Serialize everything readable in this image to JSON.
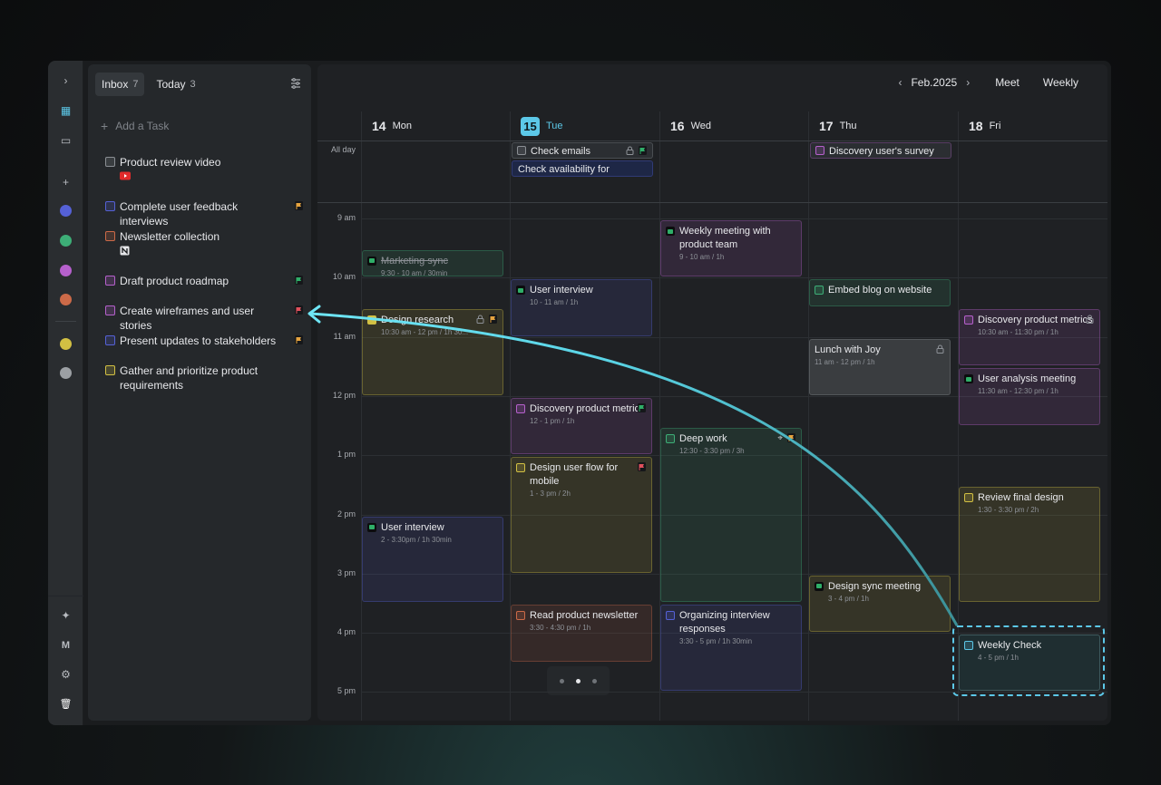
{
  "rail": {
    "icons": [
      "chevron-right-icon",
      "calendar-icon",
      "folder-icon",
      "plus-icon",
      "sparkle-icon",
      "brand-icon",
      "settings-icon",
      "trash-icon"
    ],
    "colors": [
      "#5561d6",
      "#3dae77",
      "#b660cc",
      "#cc6a48",
      "#d2c043",
      "#9ca0a4"
    ]
  },
  "tasks": {
    "tabs": [
      {
        "label": "Inbox",
        "count": "7"
      },
      {
        "label": "Today",
        "count": "3"
      }
    ],
    "add_label": "Add a Task",
    "items": [
      {
        "label": "Product review video",
        "color": "#8b8f94",
        "flag": "",
        "sub_icon": "youtube-icon"
      },
      {
        "label": "Complete user feedback interviews",
        "color": "#5561d6",
        "flag": "#e5a33f"
      },
      {
        "label": "Newsletter collection",
        "color": "#cc6a48",
        "flag": "",
        "sub_icon": "notion-icon"
      },
      {
        "label": "Draft product roadmap",
        "color": "#b660cc",
        "flag": "#2fae68"
      },
      {
        "label": "Create wireframes and user stories",
        "color": "#b660cc",
        "flag": "#e0505c"
      },
      {
        "label": "Present updates to stakeholders",
        "color": "#5561d6",
        "flag": "#e5a33f"
      },
      {
        "label": "Gather and prioritize product requirements",
        "color": "#d2c043",
        "flag": ""
      }
    ]
  },
  "calendar": {
    "month": "Feb.2025",
    "view_buttons": [
      "Meet",
      "Weekly"
    ],
    "days": [
      {
        "num": "14",
        "name": "Mon",
        "today": false
      },
      {
        "num": "15",
        "name": "Tue",
        "today": true
      },
      {
        "num": "16",
        "name": "Wed",
        "today": false
      },
      {
        "num": "17",
        "name": "Thu",
        "today": false
      },
      {
        "num": "18",
        "name": "Fri",
        "today": false
      }
    ],
    "allday_label": "All day",
    "hours": [
      "9 am",
      "10 am",
      "11 am",
      "12 pm",
      "1 pm",
      "2 pm",
      "3 pm",
      "4 pm",
      "5 pm"
    ],
    "allday_events": [
      {
        "title": "Check emails",
        "day": 1,
        "row": 0,
        "color": "#8b8f94",
        "icon": "checkbox",
        "lock": true,
        "flag": "#2fae68"
      },
      {
        "title": "Check availability for interview",
        "day": 1,
        "row": 1,
        "color": "#5561d6",
        "icon": "none"
      },
      {
        "title": "Discovery user's survey",
        "day": 3,
        "row": 0,
        "color": "#b660cc",
        "icon": "checkbox"
      }
    ],
    "events": [
      {
        "title": "Marketing sync",
        "sub": "9:30 - 10 am / 30min",
        "day": 0,
        "start": 9.5,
        "end": 10,
        "color": "#3dae77",
        "icon": "meet",
        "done": true
      },
      {
        "title": "Design research",
        "sub": "10:30 am - 12 pm / 1h 30...",
        "day": 0,
        "start": 10.5,
        "end": 12,
        "color": "#d2c043",
        "icon": "checked",
        "lock": true,
        "flag": "#e5a33f"
      },
      {
        "title": "User interview",
        "sub": "2 - 3:30pm / 1h 30min",
        "day": 0,
        "start": 14,
        "end": 15.5,
        "color": "#5561d6",
        "icon": "meet"
      },
      {
        "title": "User interview",
        "sub": "10 - 11 am / 1h",
        "day": 1,
        "start": 10,
        "end": 11,
        "color": "#5561d6",
        "icon": "meet"
      },
      {
        "title": "Discovery product metrics",
        "sub": "12 - 1 pm / 1h",
        "day": 1,
        "start": 12,
        "end": 13,
        "color": "#b660cc",
        "icon": "checkbox",
        "flag": "#2fae68"
      },
      {
        "title": "Design user flow for mobile",
        "sub": "1 - 3 pm / 2h",
        "day": 1,
        "start": 13,
        "end": 15,
        "color": "#d2c043",
        "icon": "checkbox",
        "flag": "#e0505c"
      },
      {
        "title": "Read product newsletter",
        "sub": "3:30 - 4:30 pm / 1h",
        "day": 1,
        "start": 15.5,
        "end": 16.5,
        "color": "#cc6a48",
        "icon": "checkbox"
      },
      {
        "title": "Weekly meeting with product team",
        "sub": "9 - 10 am / 1h",
        "day": 2,
        "start": 9,
        "end": 10,
        "color": "#b660cc",
        "icon": "meet"
      },
      {
        "title": "Deep work",
        "sub": "12:30 - 3:30 pm / 3h",
        "day": 2,
        "start": 12.5,
        "end": 15.5,
        "color": "#3dae77",
        "icon": "checkbox",
        "flag": "#e5a33f",
        "target": true
      },
      {
        "title": "Organizing interview responses",
        "sub": "3:30 - 5 pm / 1h 30min",
        "day": 2,
        "start": 15.5,
        "end": 17,
        "color": "#5561d6",
        "icon": "checkbox"
      },
      {
        "title": "Embed blog on website",
        "sub": "",
        "day": 3,
        "start": 10,
        "end": 10.5,
        "color": "#3dae77",
        "icon": "checkbox"
      },
      {
        "title": "Lunch with Joy",
        "sub": "11 am - 12 pm / 1h",
        "day": 3,
        "start": 11,
        "end": 12,
        "color": "#8b8f94",
        "icon": "none",
        "lock": true,
        "gray": true
      },
      {
        "title": "Design sync meeting",
        "sub": "3 - 4 pm / 1h",
        "day": 3,
        "start": 15,
        "end": 16,
        "color": "#d2c043",
        "icon": "meet"
      },
      {
        "title": "Discovery product metrics",
        "sub": "10:30 am - 11:30 pm / 1h",
        "day": 4,
        "start": 10.5,
        "end": 11.5,
        "color": "#b660cc",
        "icon": "checkbox",
        "lock": true
      },
      {
        "title": "User analysis meeting",
        "sub": "11:30 am - 12:30 pm / 1h",
        "day": 4,
        "start": 11.5,
        "end": 12.5,
        "color": "#b660cc",
        "icon": "meet"
      },
      {
        "title": "Review final design",
        "sub": "1:30 - 3:30 pm / 2h",
        "day": 4,
        "start": 13.5,
        "end": 15.5,
        "color": "#d2c043",
        "icon": "checkbox"
      },
      {
        "title": "Weekly Check",
        "sub": "4 - 5 pm / 1h",
        "day": 4,
        "start": 16,
        "end": 17,
        "color": "#5cc8e8",
        "icon": "checkbox",
        "dragging": true
      }
    ],
    "pager": {
      "pages": 3,
      "active": 1
    }
  }
}
